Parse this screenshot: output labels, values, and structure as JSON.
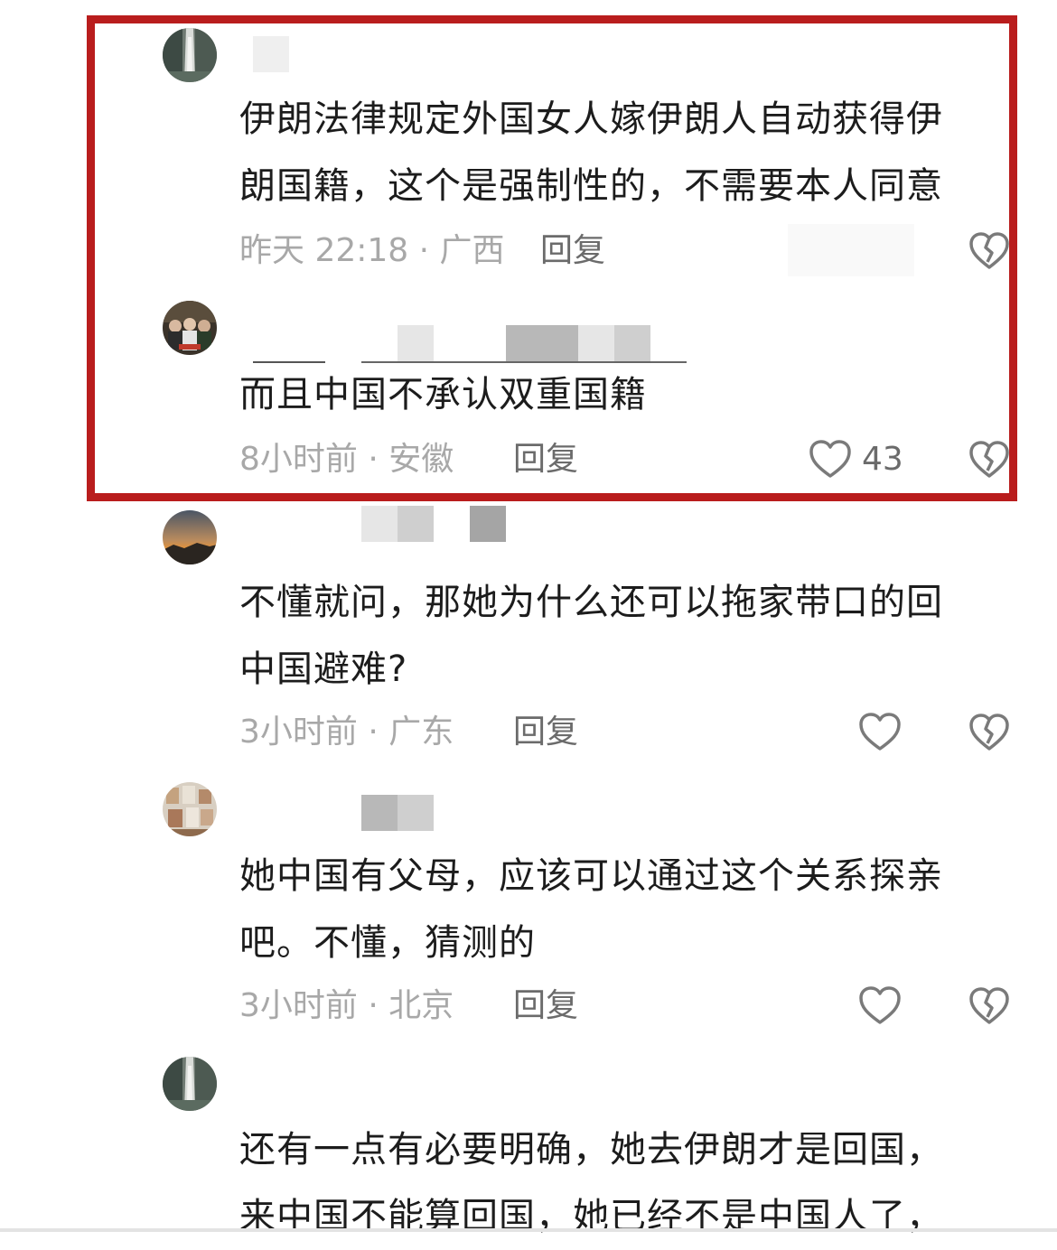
{
  "colors": {
    "highlight_border": "#b91d1d",
    "meta_text": "#a8a8a8",
    "action_text": "#6b6b6b",
    "body_text": "#1c1c1c"
  },
  "comments": [
    {
      "avatar": "waterfall-avatar",
      "line1": "伊朗法律规定外国女人嫁伊朗人自动获得伊",
      "line2": "朗国籍，这个是强制性的，不需要本人同意",
      "meta": "昨天 22:18 · 广西",
      "reply": "回复",
      "like_count": "",
      "highlighted": true
    },
    {
      "avatar": "group-photo-avatar",
      "line1": "而且中国不承认双重国籍",
      "line2": "",
      "meta": "8小时前 · 安徽",
      "reply": "回复",
      "like_count": "43",
      "highlighted": true
    },
    {
      "avatar": "sunset-avatar",
      "line1": "不懂就问，那她为什么还可以拖家带口的回",
      "line2": "中国避难?",
      "meta": "3小时前 · 广东",
      "reply": "回复",
      "like_count": ""
    },
    {
      "avatar": "photo-wall-avatar",
      "line1": "她中国有父母，应该可以通过这个关系探亲",
      "line2": "吧。不懂，猜测的",
      "meta": "3小时前 · 北京",
      "reply": "回复",
      "like_count": ""
    },
    {
      "avatar": "waterfall-avatar",
      "line1": "还有一点有必要明确，她去伊朗才是回国，",
      "line2": "来中国不能算回国，她已经不是中国人了，",
      "meta": "",
      "reply": "",
      "like_count": ""
    }
  ]
}
